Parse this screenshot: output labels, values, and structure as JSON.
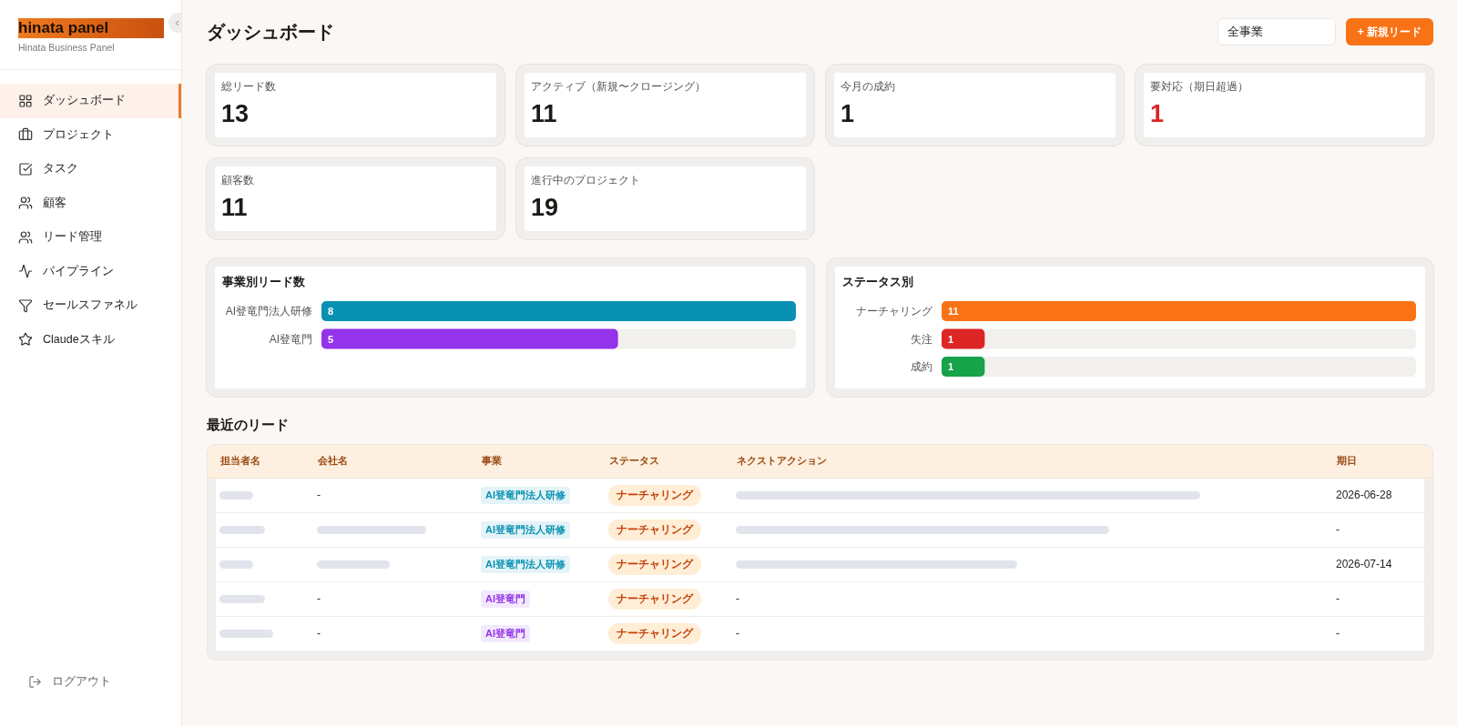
{
  "sidebar": {
    "logo": "hinata panel",
    "subtitle": "Hinata Business Panel",
    "items": [
      {
        "label": "ダッシュボード",
        "selected": true
      },
      {
        "label": "プロジェクト",
        "selected": false
      },
      {
        "label": "タスク",
        "selected": false
      },
      {
        "label": "顧客",
        "selected": false
      },
      {
        "label": "リード管理",
        "selected": false
      },
      {
        "label": "パイプライン",
        "selected": false
      },
      {
        "label": "セールスファネル",
        "selected": false
      },
      {
        "label": "Claudeスキル",
        "selected": false
      }
    ],
    "logout": "ログアウト"
  },
  "header": {
    "title": "ダッシュボード",
    "business_filter": {
      "value": "全事業"
    },
    "new_lead_button": "+ 新規リード"
  },
  "stats": [
    {
      "label": "総リード数",
      "value": "13",
      "alert": false
    },
    {
      "label": "アクティブ（新規〜クロージング）",
      "value": "11",
      "alert": false
    },
    {
      "label": "今月の成約",
      "value": "1",
      "alert": false
    },
    {
      "label": "要対応（期日超過）",
      "value": "1",
      "alert": true
    },
    {
      "label": "顧客数",
      "value": "11",
      "alert": false
    },
    {
      "label": "進行中のプロジェクト",
      "value": "19",
      "alert": false
    }
  ],
  "charts": [
    {
      "chart_data": {
        "type": "bar",
        "orientation": "horizontal",
        "title": "事業別リード数",
        "categories": [
          "AI登竜門法人研修",
          "AI登竜門"
        ],
        "series": [
          {
            "color": "#0891b2",
            "values": [
              8,
              null
            ]
          },
          {
            "color": "#9333ea",
            "values": [
              null,
              5
            ]
          }
        ],
        "data_labels": true
      }
    },
    {
      "chart_data": {
        "type": "bar",
        "orientation": "horizontal",
        "title": "ステータス別",
        "categories": [
          "ナーチャリング",
          "失注",
          "成約"
        ],
        "series": [
          {
            "color": "#f97316",
            "values": [
              11,
              null,
              null
            ]
          },
          {
            "color": "#dc2626",
            "values": [
              null,
              1,
              null
            ]
          },
          {
            "color": "#16a34a",
            "values": [
              null,
              null,
              1
            ]
          }
        ],
        "data_labels": true
      }
    }
  ],
  "recent_leads": {
    "title": "最近のリード",
    "columns": [
      "担当者名",
      "会社名",
      "事業",
      "ステータス",
      "ネクストアクション",
      "期日"
    ],
    "rows": [
      {
        "contact": {
          "kind": "redacted"
        },
        "company": {
          "kind": "text",
          "text": "-"
        },
        "business": {
          "label": "AI登竜門法人研修",
          "color": "#0891b2"
        },
        "status": "ナーチャリング",
        "next_action": {
          "kind": "redacted"
        },
        "due": "2026-06-28"
      },
      {
        "contact": {
          "kind": "redacted"
        },
        "company": {
          "kind": "redacted"
        },
        "business": {
          "label": "AI登竜門法人研修",
          "color": "#0891b2"
        },
        "status": "ナーチャリング",
        "next_action": {
          "kind": "redacted"
        },
        "due": "-"
      },
      {
        "contact": {
          "kind": "redacted"
        },
        "company": {
          "kind": "redacted"
        },
        "business": {
          "label": "AI登竜門法人研修",
          "color": "#0891b2"
        },
        "status": "ナーチャリング",
        "next_action": {
          "kind": "redacted"
        },
        "due": "2026-07-14"
      },
      {
        "contact": {
          "kind": "redacted"
        },
        "company": {
          "kind": "text",
          "text": "-"
        },
        "business": {
          "label": "AI登竜門",
          "color": "#9333ea"
        },
        "status": "ナーチャリング",
        "next_action": {
          "kind": "text",
          "text": "-"
        },
        "due": "-"
      },
      {
        "contact": {
          "kind": "redacted"
        },
        "company": {
          "kind": "text",
          "text": "-"
        },
        "business": {
          "label": "AI登竜門",
          "color": "#9333ea"
        },
        "status": "ナーチャリング",
        "next_action": {
          "kind": "text",
          "text": "-"
        },
        "due": "-"
      }
    ]
  }
}
